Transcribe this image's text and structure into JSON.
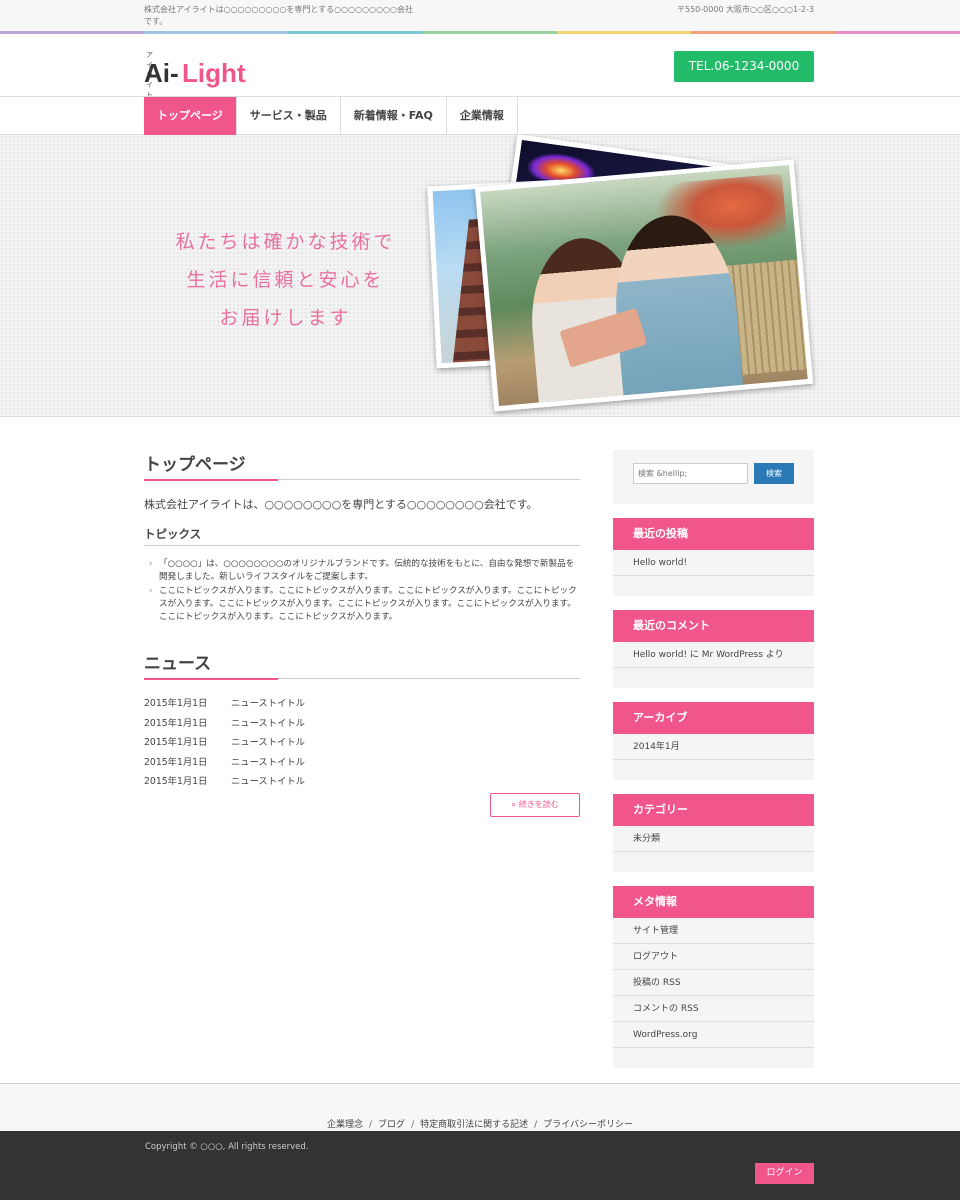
{
  "topbar": {
    "description": "株式会社アイライトは○○○○○○○○○を専門とする○○○○○○○○○会社です。",
    "address": "〒550-0000 大阪市○○区○○○1-2-3"
  },
  "header": {
    "logo_ruby": "アイライト",
    "logo_part1": "Ai-",
    "logo_part2": "Light",
    "tel": "TEL.06-1234-0000"
  },
  "nav": {
    "items": [
      {
        "label": "トップページ"
      },
      {
        "label": "サービス・製品"
      },
      {
        "label": "新着情報・FAQ"
      },
      {
        "label": "企業情報"
      }
    ]
  },
  "hero": {
    "lines": [
      "私たちは確かな技術で",
      "生活に信頼と安心を",
      "お届けします"
    ]
  },
  "main": {
    "top_title": "トップページ",
    "intro": "株式会社アイライトは、○○○○○○○○を専門とする○○○○○○○○会社です。",
    "topics_heading": "トピックス",
    "topics": [
      "「○○○○」は、○○○○○○○○のオリジナルブランドです。伝統的な技術をもとに、自由な発想で新製品を開発しました。新しいライフスタイルをご提案します。",
      "ここにトピックスが入ります。ここにトピックスが入ります。ここにトピックスが入ります。ここにトピックスが入ります。ここにトピックスが入ります。ここにトピックスが入ります。ここにトピックスが入ります。ここにトピックスが入ります。ここにトピックスが入ります。"
    ],
    "news_title": "ニュース",
    "news": [
      {
        "date": "2015年1月1日",
        "title": "ニューストイトル"
      },
      {
        "date": "2015年1月1日",
        "title": "ニューストイトル"
      },
      {
        "date": "2015年1月1日",
        "title": "ニューストイトル"
      },
      {
        "date": "2015年1月1日",
        "title": "ニューストイトル"
      },
      {
        "date": "2015年1月1日",
        "title": "ニューストイトル"
      }
    ],
    "more_label": "» 続きを読む"
  },
  "sidebar": {
    "search_placeholder": "検索 &hellip;",
    "search_button": "検索",
    "recent_posts_title": "最近の投稿",
    "recent_posts": [
      "Hello world!"
    ],
    "recent_comments_title": "最近のコメント",
    "recent_comments": [
      "Hello world! に Mr WordPress より"
    ],
    "archives_title": "アーカイブ",
    "archives": [
      "2014年1月"
    ],
    "categories_title": "カテゴリー",
    "categories": [
      "未分類"
    ],
    "meta_title": "メタ情報",
    "meta": [
      "サイト管理",
      "ログアウト",
      "投稿の RSS",
      "コメントの RSS",
      "WordPress.org"
    ]
  },
  "footer": {
    "links": [
      "企業理念",
      "ブログ",
      "特定商取引法に関する記述",
      "プライバシーポリシー"
    ],
    "separator": "/",
    "copyright": "Copyright © ○○○, All rights reserved.",
    "login": "ログイン"
  },
  "colors": {
    "accent": "#f0568b",
    "tel_green": "#22bb6a",
    "search_blue": "#2a7ab8",
    "footer_dark": "#333333"
  }
}
